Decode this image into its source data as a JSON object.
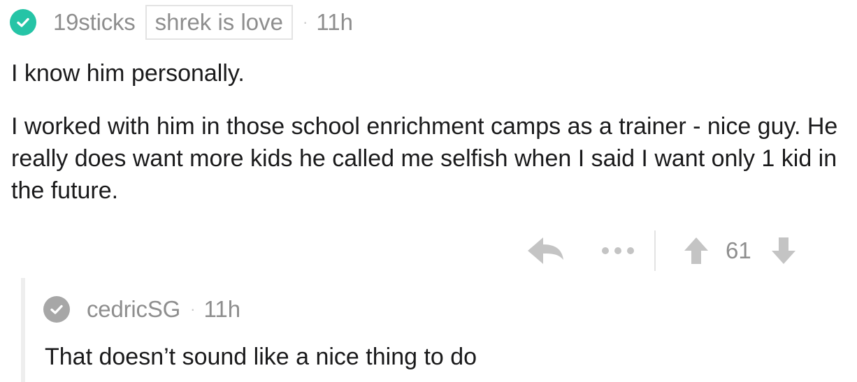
{
  "comment": {
    "username": "19sticks",
    "flair": "shrek is love",
    "separator": "·",
    "time": "11h",
    "paragraphs": [
      "I know him personally.",
      "I worked with him in those school enrichment camps as a trainer - nice guy. He really does want more kids he called me selfish when I said I want only 1 kid in the future."
    ],
    "actions": {
      "reply_icon": "reply-arrow-icon",
      "more_icon": "more-dots-icon",
      "upvote_icon": "upvote-arrow-icon",
      "score": "61",
      "downvote_icon": "downvote-arrow-icon"
    },
    "badge_color": "#25c4a6"
  },
  "reply": {
    "username": "cedricSG",
    "separator": "·",
    "time": "11h",
    "body": "That doesn’t sound like a nice thing to do",
    "badge_color": "#a7a7a7"
  }
}
